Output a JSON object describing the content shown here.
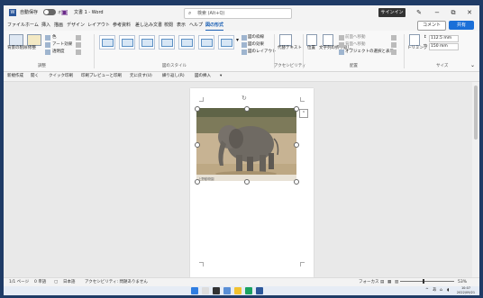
{
  "titlebar": {
    "autosave_label": "自動保存",
    "autosave_state": "オフ",
    "doc_title": "文書 1 - Word",
    "search_placeholder": "検索 (Alt+Q)",
    "signin": "サインイン",
    "app_icon": "W"
  },
  "menubar": {
    "tabs": [
      "ファイル",
      "ホーム",
      "挿入",
      "描画",
      "デザイン",
      "レイアウト",
      "参考資料",
      "差し込み文書",
      "校閲",
      "表示",
      "ヘルプ",
      "図の形式"
    ],
    "active_tab": "図の形式",
    "comment": "コメント",
    "share": "共有"
  },
  "ribbon": {
    "adjust": {
      "label": "調整",
      "remove_bg": "背景の削除",
      "corrections": "修整",
      "color": "色",
      "artistic": "アート効果",
      "transparency": "透明度"
    },
    "styles": {
      "label": "図のスタイル"
    },
    "picture_options": {
      "border": "図の枠線",
      "effects": "図の効果",
      "layout": "図のレイアウト"
    },
    "accessibility": {
      "label": "アクセシビリティ",
      "alt_text": "代替テキスト"
    },
    "arrange": {
      "label": "配置",
      "position": "位置",
      "wrap": "文字列の折り返し",
      "forward": "前面へ移動",
      "backward": "背面へ移動",
      "selection_pane": "オブジェクトの選択と表示"
    },
    "size": {
      "label": "サイズ",
      "crop": "トリミング",
      "height": "112.5 mm",
      "width": "150 mm"
    }
  },
  "toolbar2": {
    "items": [
      "新規作成",
      "開く",
      "クイック印刷",
      "印刷プレビューと印刷",
      "元に戻す(U)",
      "繰り返し(R)",
      "図の挿入"
    ]
  },
  "photo": {
    "caption": "上野動物園"
  },
  "statusbar": {
    "page": "1/1 ページ",
    "words": "0 単語",
    "language": "日本語",
    "accessibility": "アクセシビリティ: 問題ありません",
    "focus": "フォーカス",
    "zoom": "53%",
    "zoom_fraction": 0.5
  },
  "taskbar": {
    "tray_caret": "^",
    "ime": "あ",
    "clock_time": "10:07",
    "clock_date": "2022/09/21"
  },
  "colors": {
    "accent": "#1a5fb4",
    "share": "#1a6fd8",
    "titlebar": "#f3f3f3"
  }
}
